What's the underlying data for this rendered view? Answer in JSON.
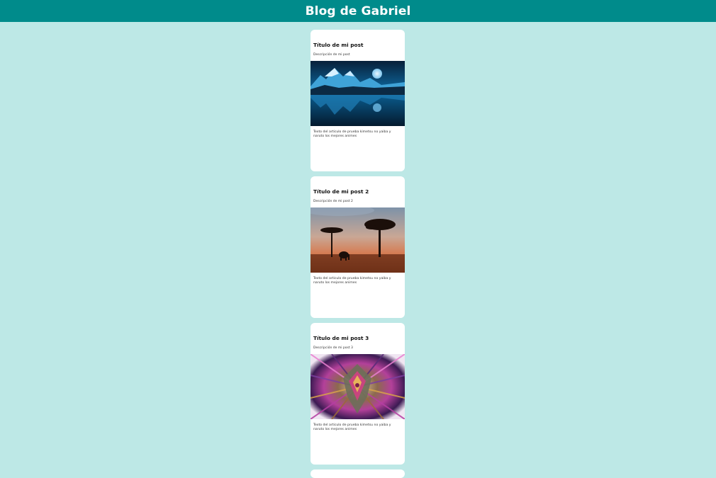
{
  "header": {
    "title": "Blog de Gabriel"
  },
  "posts": [
    {
      "title": "Título de mi post",
      "description": "Descripción de mi post",
      "image_icon": "night-lake-moon-image",
      "text": "Texto del articulo de prueba kimetsu no yaiba y naruto los mejores animes"
    },
    {
      "title": "Título de mi post 2",
      "description": "Descripción de mi post 2",
      "image_icon": "savanna-sunset-image",
      "text": "Texto del articulo de prueba kimetsu no yaiba y naruto los mejores animes"
    },
    {
      "title": "Título de mi post 3",
      "description": "Descripción de mi post 3",
      "image_icon": "fractal-pattern-image",
      "text": "Texto del articulo de prueba kimetsu no yaiba y naruto los mejores animes"
    }
  ],
  "colors": {
    "header_bg": "#008b8b",
    "page_bg": "#bde8e6",
    "card_bg": "#ffffff"
  }
}
